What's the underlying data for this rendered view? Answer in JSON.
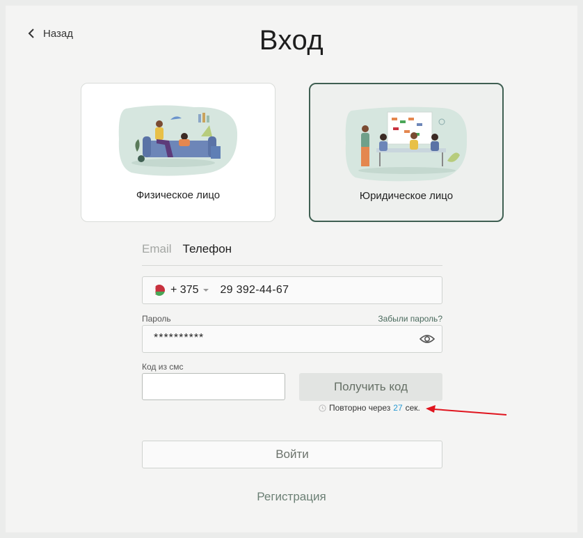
{
  "header": {
    "back_label": "Назад",
    "title": "Вход"
  },
  "account_types": [
    {
      "label": "Физическое лицо",
      "illustration": "people-on-sofa-illustration"
    },
    {
      "label": "Юридическое лицо",
      "illustration": "office-meeting-illustration",
      "selected": true
    }
  ],
  "login_tabs": [
    {
      "label": "Email",
      "active": false
    },
    {
      "label": "Телефон",
      "active": true
    }
  ],
  "phone": {
    "country_flag": "by-flag-icon",
    "code": "+ 375",
    "number": "29 392-44-67"
  },
  "password": {
    "label": "Пароль",
    "forgot_label": "Забыли пароль?",
    "value": "**********",
    "toggle_icon": "eye-icon"
  },
  "sms": {
    "label": "Код из смс",
    "value": "",
    "get_code_label": "Получить код",
    "resend_prefix": "Повторно через",
    "resend_seconds": "27",
    "resend_suffix": "сек."
  },
  "actions": {
    "login_label": "Войти",
    "register_label": "Регистрация"
  },
  "colors": {
    "accent_border": "#3f5f52",
    "timer": "#2a9bd3",
    "annotation_arrow": "#e0141e"
  }
}
